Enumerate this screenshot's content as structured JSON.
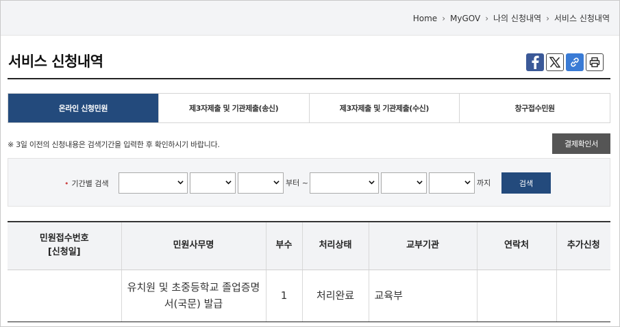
{
  "breadcrumb": [
    "Home",
    "MyGOV",
    "나의 신청내역",
    "서비스 신청내역"
  ],
  "page_title": "서비스 신청내역",
  "share": {
    "facebook": "facebook-icon",
    "x": "x-icon",
    "link": "link-icon",
    "print": "print-icon"
  },
  "tabs": [
    {
      "label": "온라인 신청민원",
      "active": true
    },
    {
      "label": "제3자제출 및 기관제출(송신)",
      "active": false
    },
    {
      "label": "제3자제출 및 기관제출(수신)",
      "active": false
    },
    {
      "label": "창구접수민원",
      "active": false
    }
  ],
  "notice": "※ 3일 이전의 신청내용은 검색기간을 입력한 후 확인하시기 바랍니다.",
  "receipt_button": "결제확인서",
  "search": {
    "label": "기간별 검색",
    "from_text": "부터 ~",
    "to_text": "까지",
    "button": "검색"
  },
  "table": {
    "headers": {
      "receipt_no_line1": "민원접수번호",
      "receipt_no_line2": "[신청일]",
      "service_name": "민원사무명",
      "copies": "부수",
      "status": "처리상태",
      "issuer": "교부기관",
      "contact": "연락처",
      "additional": "추가신청"
    },
    "rows": [
      {
        "receipt_no": "",
        "service_name_line1": "유치원 및 초중등학교 졸업증명",
        "service_name_line2": "서(국문) 발급",
        "copies": "1",
        "status": "처리완료",
        "issuer": "교육부",
        "contact": "",
        "additional": ""
      }
    ]
  },
  "colors": {
    "primary": "#234a7c",
    "facebook": "#3b5998",
    "link": "#3a7bd5",
    "dark_button": "#555555"
  }
}
